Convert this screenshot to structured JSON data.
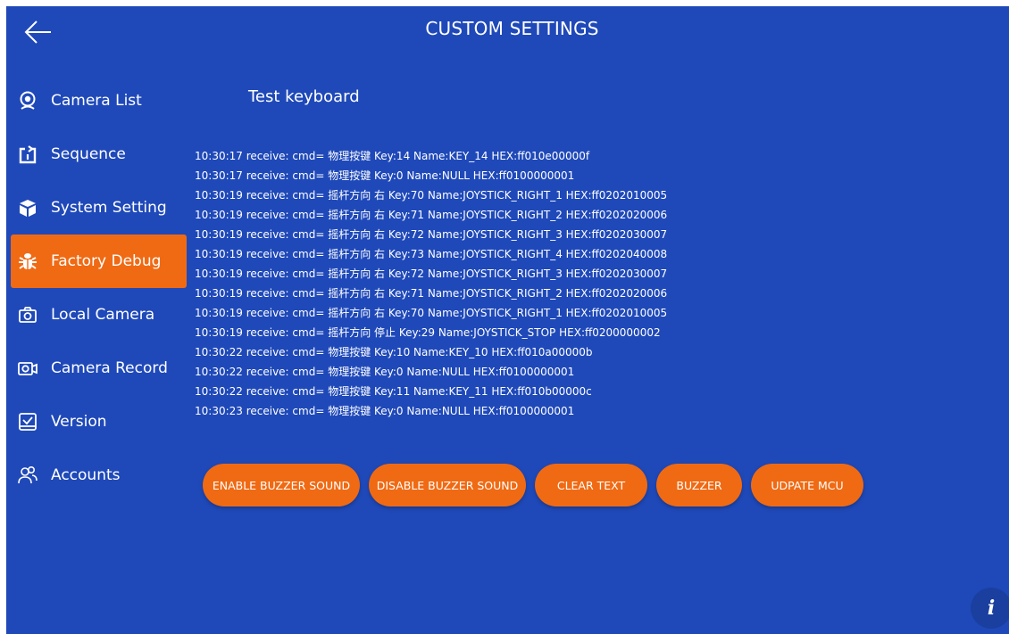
{
  "header": {
    "title": "CUSTOM SETTINGS",
    "back_icon": "arrow-left-icon"
  },
  "sidebar": {
    "items": [
      {
        "label": "Camera List",
        "icon": "webcam-icon",
        "active": false
      },
      {
        "label": "Sequence",
        "icon": "sequence-icon",
        "active": false
      },
      {
        "label": "System Setting",
        "icon": "cube-icon",
        "active": false
      },
      {
        "label": "Factory Debug",
        "icon": "bug-icon",
        "active": true
      },
      {
        "label": "Local Camera",
        "icon": "camera-icon",
        "active": false
      },
      {
        "label": "Camera Record",
        "icon": "video-camera-icon",
        "active": false
      },
      {
        "label": "Version",
        "icon": "version-icon",
        "active": false
      },
      {
        "label": "Accounts",
        "icon": "users-icon",
        "active": false
      }
    ]
  },
  "main": {
    "section_title": "Test keyboard",
    "log_lines": [
      "10:30:17 receive: cmd= 物理按键 Key:14 Name:KEY_14 HEX:ff010e00000f",
      "10:30:17 receive: cmd= 物理按键 Key:0 Name:NULL HEX:ff0100000001",
      "10:30:19 receive: cmd= 摇杆方向 右 Key:70 Name:JOYSTICK_RIGHT_1 HEX:ff0202010005",
      "10:30:19 receive: cmd= 摇杆方向 右 Key:71 Name:JOYSTICK_RIGHT_2 HEX:ff0202020006",
      "10:30:19 receive: cmd= 摇杆方向 右 Key:72 Name:JOYSTICK_RIGHT_3 HEX:ff0202030007",
      "10:30:19 receive: cmd= 摇杆方向 右 Key:73 Name:JOYSTICK_RIGHT_4 HEX:ff0202040008",
      "10:30:19 receive: cmd= 摇杆方向 右 Key:72 Name:JOYSTICK_RIGHT_3 HEX:ff0202030007",
      "10:30:19 receive: cmd= 摇杆方向 右 Key:71 Name:JOYSTICK_RIGHT_2 HEX:ff0202020006",
      "10:30:19 receive: cmd= 摇杆方向 右 Key:70 Name:JOYSTICK_RIGHT_1 HEX:ff0202010005",
      "10:30:19 receive: cmd= 摇杆方向 停止 Key:29 Name:JOYSTICK_STOP HEX:ff0200000002",
      "10:30:22 receive: cmd= 物理按键 Key:10 Name:KEY_10 HEX:ff010a00000b",
      "10:30:22 receive: cmd= 物理按键 Key:0 Name:NULL HEX:ff0100000001",
      "10:30:22 receive: cmd= 物理按键 Key:11 Name:KEY_11 HEX:ff010b00000c",
      "10:30:23 receive: cmd= 物理按键 Key:0 Name:NULL HEX:ff0100000001"
    ],
    "buttons": {
      "enable_buzzer": "ENABLE BUZZER SOUND",
      "disable_buzzer": "DISABLE BUZZER SOUND",
      "clear_text": "CLEAR TEXT",
      "buzzer": "BUZZER",
      "update_mcu": "UDPATE MCU"
    }
  },
  "info_button": {
    "label": "i",
    "icon": "info-icon"
  },
  "colors": {
    "background": "#1f49b9",
    "accent": "#f06a13",
    "text": "#ffffff"
  }
}
